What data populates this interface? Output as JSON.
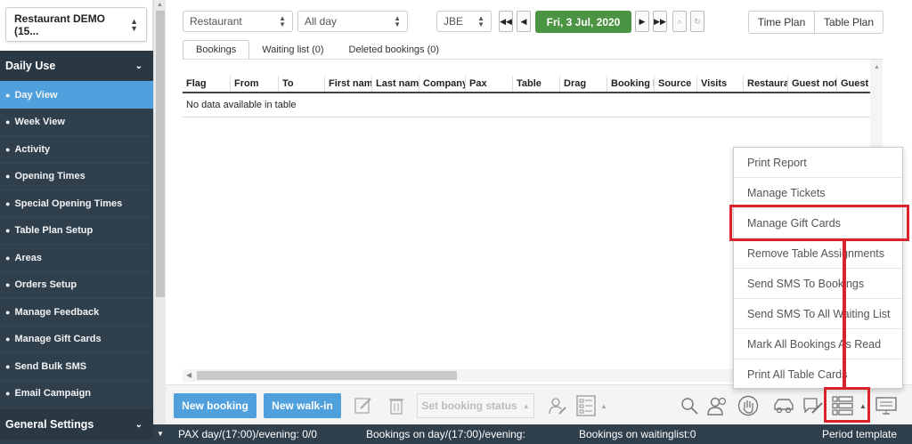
{
  "sidebar": {
    "restaurant": "Restaurant DEMO (15...",
    "section_daily": "Daily Use",
    "items": [
      {
        "label": "Day View"
      },
      {
        "label": "Week View"
      },
      {
        "label": "Activity"
      },
      {
        "label": "Opening Times"
      },
      {
        "label": "Special Opening Times"
      },
      {
        "label": "Table Plan Setup"
      },
      {
        "label": "Areas"
      },
      {
        "label": "Orders Setup"
      },
      {
        "label": "Manage Feedback"
      },
      {
        "label": "Manage Gift Cards"
      },
      {
        "label": "Send Bulk SMS"
      },
      {
        "label": "Email Campaign"
      }
    ],
    "section_general": "General Settings"
  },
  "top": {
    "restaurant_select": "Restaurant",
    "time_select": "All day",
    "user_select": "JBE",
    "date": "Fri, 3 Jul, 2020",
    "time_plan": "Time Plan",
    "table_plan": "Table Plan"
  },
  "tabs": [
    "Bookings",
    "Waiting list (0)",
    "Deleted bookings (0)"
  ],
  "table": {
    "columns": [
      "Flag",
      "From",
      "To",
      "First name",
      "Last name",
      "Company",
      "Pax",
      "Table",
      "Drag",
      "Booking I",
      "Source",
      "Visits",
      "Restaurant",
      "Guest not",
      "Guest"
    ],
    "empty_text": "No data available in table"
  },
  "toolbar": {
    "new_booking": "New booking",
    "new_walkin": "New walk-in",
    "set_status": "Set booking status"
  },
  "menu": {
    "items": [
      "Print Report",
      "Manage Tickets",
      "Manage Gift Cards",
      "Remove Table Assignments",
      "Send SMS To Bookings",
      "Send SMS To All Waiting List",
      "Mark All Bookings As Read",
      "Print All Table Cards"
    ]
  },
  "status": {
    "pax": "PAX day/(17:00)/evening: 0/0",
    "bookings": "Bookings on day/(17:00)/evening:",
    "waiting": "Bookings on waitinglist:0",
    "template": "Period template"
  },
  "colors": {
    "sidebar": "#2f3f4c",
    "active": "#4fa0dc",
    "date_green": "#4b9443",
    "highlight": "#d9232d"
  }
}
